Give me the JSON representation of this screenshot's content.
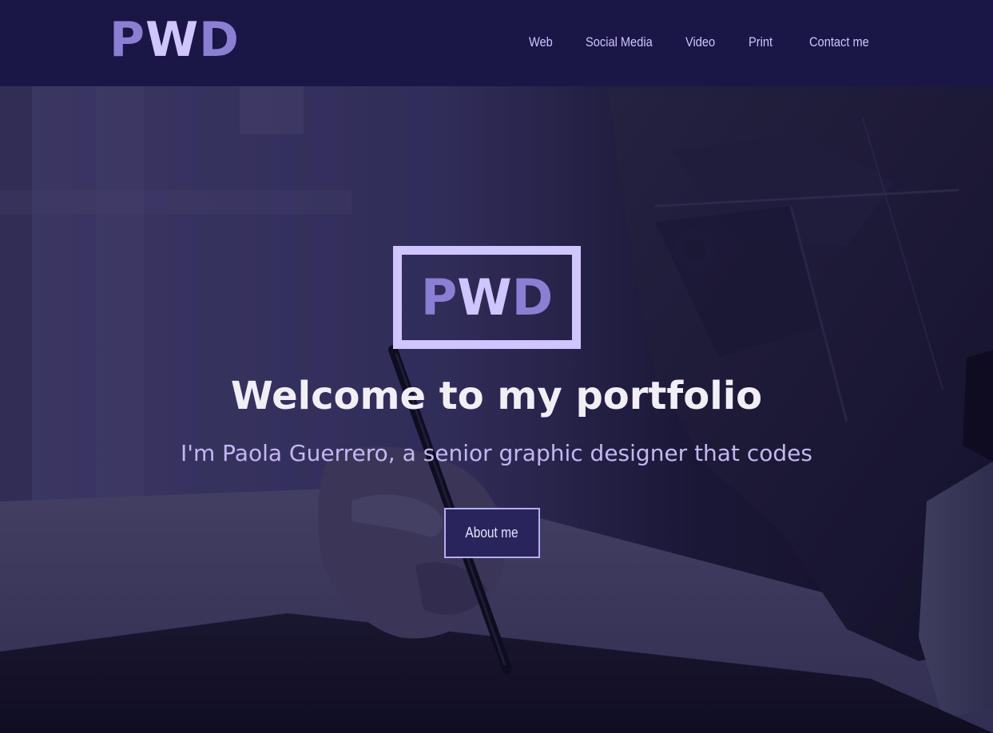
{
  "navbar": {
    "logo": {
      "letters": [
        "P",
        "W",
        "D"
      ]
    },
    "links": [
      "Web",
      "Social Media",
      "Video",
      "Print",
      "Contact me"
    ]
  },
  "hero": {
    "logo": {
      "letters": [
        "P",
        "W",
        "D"
      ]
    },
    "title": "Welcome to my portfolio",
    "subtitle": "I'm Paola Guerrero, a senior graphic designer that codes",
    "button_label": "About me"
  },
  "colors": {
    "nav_background": "#1a1645",
    "brand_light": "#cfc5ff",
    "brand_mid": "#8b7fd3",
    "title_text": "#f1eef6",
    "subtitle_text": "#c3b8f2"
  }
}
